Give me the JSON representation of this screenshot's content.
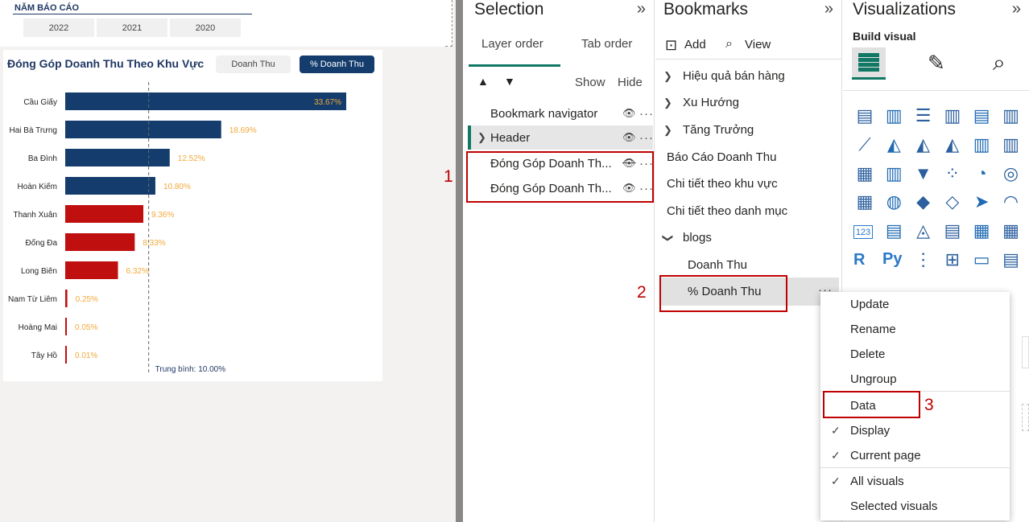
{
  "canvas": {
    "slicer": {
      "title": "NĂM BÁO CÁO",
      "years": [
        "2022",
        "2021",
        "2020"
      ]
    },
    "chart": {
      "title": "Đóng Góp Doanh Thu Theo Khu Vực",
      "toggle": [
        "Doanh Thu",
        "% Doanh Thu"
      ],
      "avg_label": "Trung bình: 10.00%"
    }
  },
  "chart_data": {
    "type": "bar",
    "orientation": "horizontal",
    "title": "Đóng Góp Doanh Thu Theo Khu Vực",
    "categories": [
      "Cầu Giấy",
      "Hai Bà Trưng",
      "Ba Đình",
      "Hoàn Kiếm",
      "Thanh Xuân",
      "Đống Đa",
      "Long Biên",
      "Nam Từ Liêm",
      "Hoàng Mai",
      "Tây Hồ"
    ],
    "values": [
      33.67,
      18.69,
      12.52,
      10.8,
      9.36,
      8.33,
      6.32,
      0.25,
      0.05,
      0.01
    ],
    "labels": [
      "33.67%",
      "18.69%",
      "12.52%",
      "10.80%",
      "9.36%",
      "8.33%",
      "6.32%",
      "0.25%",
      "0.05%",
      "0.01%"
    ],
    "average": 10.0,
    "xlim": [
      0,
      34
    ],
    "colors": {
      "above": "#143d6d",
      "below": "#c00f0f",
      "label": "#f2a93b"
    }
  },
  "selection": {
    "title": "Selection",
    "tabs": [
      "Layer order",
      "Tab order"
    ],
    "show": "Show",
    "hide": "Hide",
    "layers": [
      "Bookmark navigator",
      "Header",
      "Đóng Góp Doanh Th...",
      "Đóng Góp Doanh Th..."
    ],
    "callout": "1"
  },
  "bookmarks": {
    "title": "Bookmarks",
    "add": "Add",
    "view": "View",
    "items": [
      "Hiệu quả bán hàng",
      "Xu Hướng",
      "Tăng Trưởng",
      "Báo Cáo Doanh Thu",
      "Chi tiết theo khu vực",
      "Chi tiết theo danh mục",
      "blogs",
      "Doanh Thu",
      "% Doanh Thu"
    ],
    "callout": "2"
  },
  "visualizations": {
    "title": "Visualizations",
    "build": "Build visual",
    "icons": [
      "stacked-bar-icon",
      "stacked-column-icon",
      "clustered-bar-icon",
      "clustered-column-icon",
      "100-bar-icon",
      "100-column-icon",
      "line-chart-icon",
      "area-chart-icon",
      "stacked-area-icon",
      "ribbon-icon",
      "line-column-icon",
      "line-stacked-column-icon",
      "waterfall-icon",
      "column-icon",
      "funnel-icon",
      "scatter-icon",
      "pie-icon",
      "donut-icon",
      "treemap-icon",
      "map-icon",
      "filled-map-icon",
      "shape-map-icon",
      "azure-map-icon",
      "gauge-icon",
      "card-icon",
      "multirow-card-icon",
      "kpi-icon",
      "slicer-icon",
      "table-icon",
      "matrix-icon",
      "r-visual-icon",
      "python-visual-icon",
      "key-influencers-icon",
      "decomposition-tree-icon",
      "qa-icon",
      "narrative-icon"
    ],
    "r_label": "R",
    "py_label": "Py",
    "card_label": "123"
  },
  "context_menu": {
    "items": [
      "Update",
      "Rename",
      "Delete",
      "Ungroup",
      "Data",
      "Display",
      "Current page",
      "All visuals",
      "Selected visuals"
    ],
    "callout": "3"
  }
}
